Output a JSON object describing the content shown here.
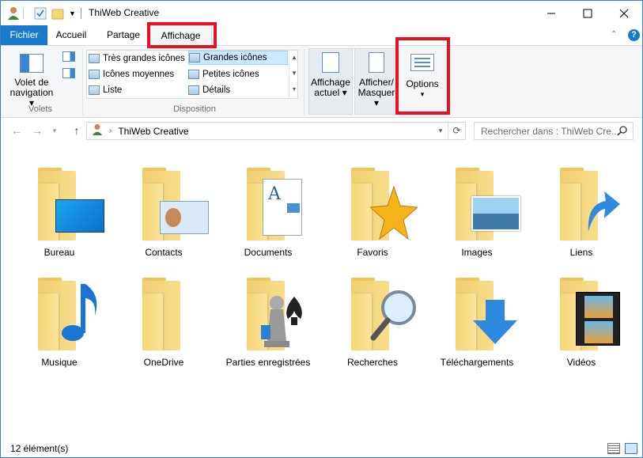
{
  "window": {
    "title": "ThiWeb Creative",
    "minimize": "—",
    "maximize": "☐",
    "close": "✕"
  },
  "ribbon_tabs": {
    "file": "Fichier",
    "home": "Accueil",
    "share": "Partage",
    "view": "Affichage",
    "collapse_icon": "chevron-up-icon",
    "help_icon": "help-icon"
  },
  "panes_group": {
    "nav_pane_line1": "Volet de",
    "nav_pane_line2": "navigation",
    "label": "Volets"
  },
  "layout_group": {
    "items": {
      "extra_large": "Très grandes icônes",
      "large": "Grandes icônes",
      "medium": "Icônes moyennes",
      "small": "Petites icônes",
      "list": "Liste",
      "details": "Détails"
    },
    "selected": "Grandes icônes",
    "label": "Disposition"
  },
  "current_view": {
    "line1": "Affichage",
    "line2": "actuel"
  },
  "show_hide": {
    "line1": "Afficher/",
    "line2": "Masquer"
  },
  "options": {
    "label": "Options"
  },
  "address": {
    "path": "ThiWeb Creative",
    "search_placeholder": "Rechercher dans : ThiWeb Cre..."
  },
  "items": [
    {
      "label": "Bureau",
      "overlay": "desktop-icon"
    },
    {
      "label": "Contacts",
      "overlay": "contact-card-icon"
    },
    {
      "label": "Documents",
      "overlay": "document-icon"
    },
    {
      "label": "Favoris",
      "overlay": "star-icon"
    },
    {
      "label": "Images",
      "overlay": "picture-icon"
    },
    {
      "label": "Liens",
      "overlay": "link-arrow-icon"
    },
    {
      "label": "Musique",
      "overlay": "music-note-icon"
    },
    {
      "label": "OneDrive",
      "overlay": ""
    },
    {
      "label": "Parties enregistrées",
      "overlay": "chess-icon"
    },
    {
      "label": "Recherches",
      "overlay": "magnifier-icon"
    },
    {
      "label": "Téléchargements",
      "overlay": "download-arrow-icon"
    },
    {
      "label": "Vidéos",
      "overlay": "film-icon"
    }
  ],
  "status": {
    "count": "12 élément(s)"
  },
  "colors": {
    "accent": "#1979ca",
    "highlight": "#e81123",
    "folder": "#f4d675"
  }
}
